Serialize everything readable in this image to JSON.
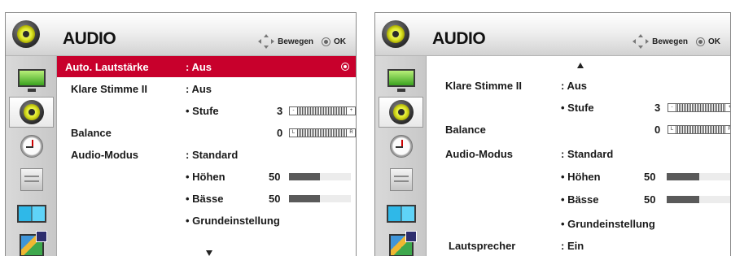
{
  "common": {
    "title": "AUDIO",
    "hint_move": "Bewegen",
    "hint_ok": "OK",
    "selection_color": "#c8002c",
    "sidebar_icons": [
      "monitor-icon",
      "speaker-icon",
      "clock-icon",
      "case-icon",
      "screens-icon",
      "photo-icon"
    ]
  },
  "left": {
    "auto_volume": {
      "label": "Auto. Lautstärke",
      "value": ": Aus"
    },
    "clear_voice": {
      "label": "Klare Stimme II",
      "value": ": Aus"
    },
    "level": {
      "label": "• Stufe",
      "value": "3",
      "min_label": "-",
      "max_label": "+"
    },
    "balance": {
      "label": "Balance",
      "value": "0",
      "min_label": "L",
      "max_label": "R"
    },
    "audio_mode": {
      "label": "Audio-Modus",
      "value": ": Standard"
    },
    "treble": {
      "label": "• Höhen",
      "value": "50",
      "level": 0.5
    },
    "bass": {
      "label": "• Bässe",
      "value": "50",
      "level": 0.5
    },
    "reset": {
      "label": "• Grundeinstellung"
    }
  },
  "right": {
    "clear_voice": {
      "label": "Klare Stimme II",
      "value": ": Aus"
    },
    "level": {
      "label": "• Stufe",
      "value": "3",
      "min_label": "-",
      "max_label": "+"
    },
    "balance": {
      "label": "Balance",
      "value": "0",
      "min_label": "L",
      "max_label": "R"
    },
    "audio_mode": {
      "label": "Audio-Modus",
      "value": ": Standard"
    },
    "treble": {
      "label": "• Höhen",
      "value": "50",
      "level": 0.5
    },
    "bass": {
      "label": "• Bässe",
      "value": "50",
      "level": 0.5
    },
    "reset": {
      "label": "• Grundeinstellung"
    },
    "speaker": {
      "label": "Lautsprecher",
      "value": ": Ein"
    }
  }
}
